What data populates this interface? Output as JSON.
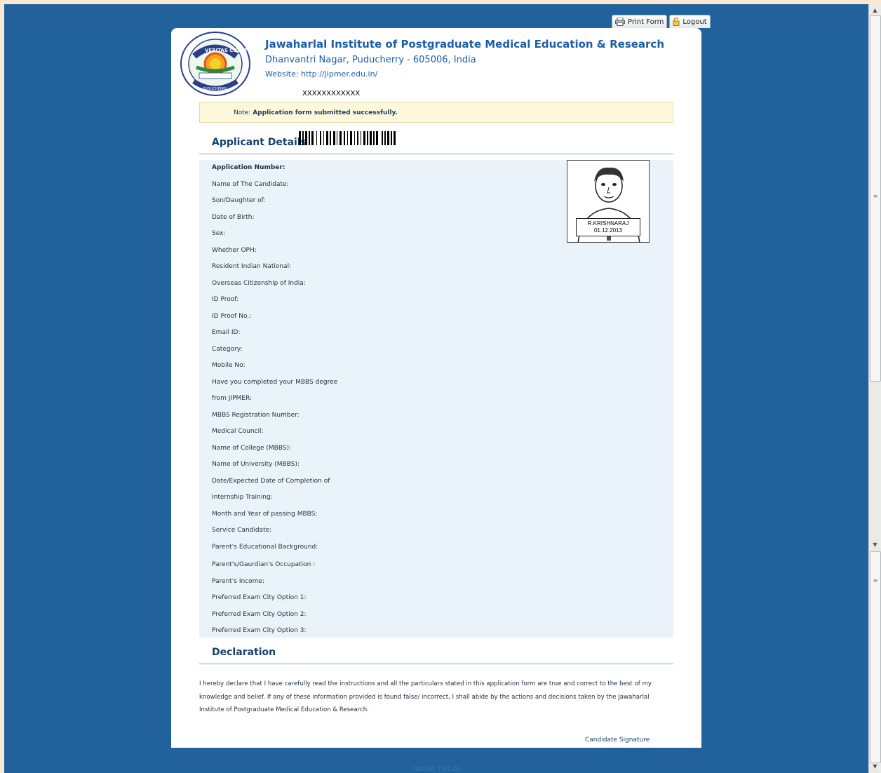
{
  "toolbar": {
    "print_label": "Print Form",
    "logout_label": "Logout"
  },
  "header": {
    "institute_name": "Jawaharlal Institute of Postgraduate Medical Education & Research",
    "address": "Dhanvantri Nagar, Puducherry - 605006, India",
    "website": "Website: http://jipmer.edu.in/",
    "application_no_top": "XXXXXXXXXXXX",
    "seal_text_top": "VERITAS CURAT",
    "seal_text_bottom": "PUDUCHERRY"
  },
  "note": {
    "prefix": "Note:",
    "message": "Application form submitted successfully."
  },
  "applicant_details": {
    "title": "Applicant Details",
    "fields": [
      "Application Number:",
      "Name of The Candidate:",
      "Son/Daughter of:",
      "Date of Birth:",
      "Sex:",
      "Whether OPH:",
      "Resident Indian National:",
      "Overseas Citizenship of India:",
      "ID Proof:",
      "ID Proof No.:",
      "Email ID:",
      "Category:",
      "Mobile No:",
      "Have you completed your MBBS degree",
      "from JIPMER:",
      "MBBS Registration Number:",
      "Medical Council:",
      "Name of College (MBBS):",
      "Name of University (MBBS):",
      "Date/Expected Date of Completion of",
      "Internship Training:",
      "Month and Year of passing MBBS:",
      "Service Candidate:",
      "Parent's Educational Background:",
      "Parent's/Gaurdian's Occupation :",
      "Parent's Income:",
      "Preferred Exam City Option 1:",
      "Preferred Exam City Option 2:",
      "Preferred Exam City Option 3:"
    ],
    "photo": {
      "name": "R.KRISHNARAJ",
      "date": "01.12.2013"
    }
  },
  "declaration": {
    "title": "Declaration",
    "text": "I hereby declare that I have carefully read the instructions and all the particulars stated in this application form are true and correct to the best of my knowledge and belief. If any of these information provided is found false/ incorrect, I shall abide by the actions and decisions taken by the Jawaharlal Institute of Postgraduate Medical Education & Research.",
    "signature_label": "Candidate Signature"
  },
  "footer": {
    "version": "Version 7.01.02"
  },
  "colors": {
    "page_background": "#22629c",
    "heading_blue": "#1b5fa8",
    "details_background": "#ebf3fa",
    "note_background": "#fcf8dc"
  }
}
